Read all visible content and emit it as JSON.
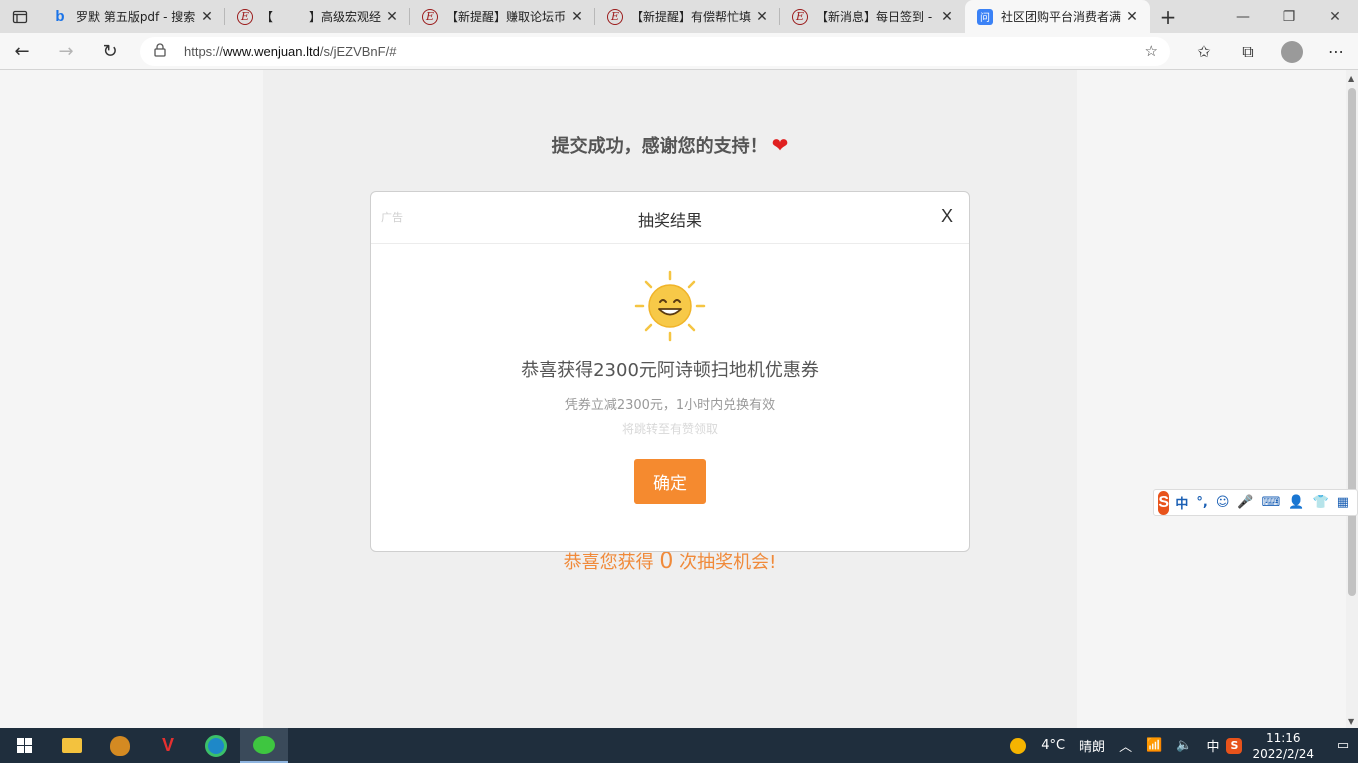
{
  "browser": {
    "tabs": [
      {
        "title": "罗默 第五版pdf - 搜索",
        "icon": "bing-icon"
      },
      {
        "title": "【　　　】高级宏观经",
        "icon": "e-forum-icon"
      },
      {
        "title": "【新提醒】赚取论坛币",
        "icon": "e-forum-icon"
      },
      {
        "title": "【新提醒】有偿帮忙填",
        "icon": "e-forum-icon"
      },
      {
        "title": "【新消息】每日签到 -",
        "icon": "e-forum-icon"
      },
      {
        "title": "社区团购平台消费者满",
        "icon": "wenjuan-icon",
        "active": true
      }
    ],
    "url_prefix": "https://",
    "url_host": "www.wenjuan.ltd",
    "url_path": "/s/jEZVBnF/#"
  },
  "page": {
    "headline": "提交成功，感谢您的支持！",
    "chance_prefix": "恭喜您获得",
    "chance_count": "0",
    "chance_suffix": "次抽奖机会!"
  },
  "modal": {
    "ad_label": "广告",
    "title": "抽奖结果",
    "close_label": "X",
    "prize": "恭喜获得2300元阿诗顿扫地机优惠券",
    "description": "凭券立减2300元，1小时内兑换有效",
    "redirect_note": "将跳转至有赞领取",
    "confirm_label": "确定"
  },
  "ime": {
    "mode": "中",
    "punct": "°,"
  },
  "taskbar": {
    "temperature": "4°C",
    "weather": "晴朗",
    "input_mode": "中",
    "time": "11:16",
    "date": "2022/2/24"
  },
  "colors": {
    "accent": "#f58a2f",
    "chance_text": "#f08a3a",
    "heart": "#e02020"
  }
}
